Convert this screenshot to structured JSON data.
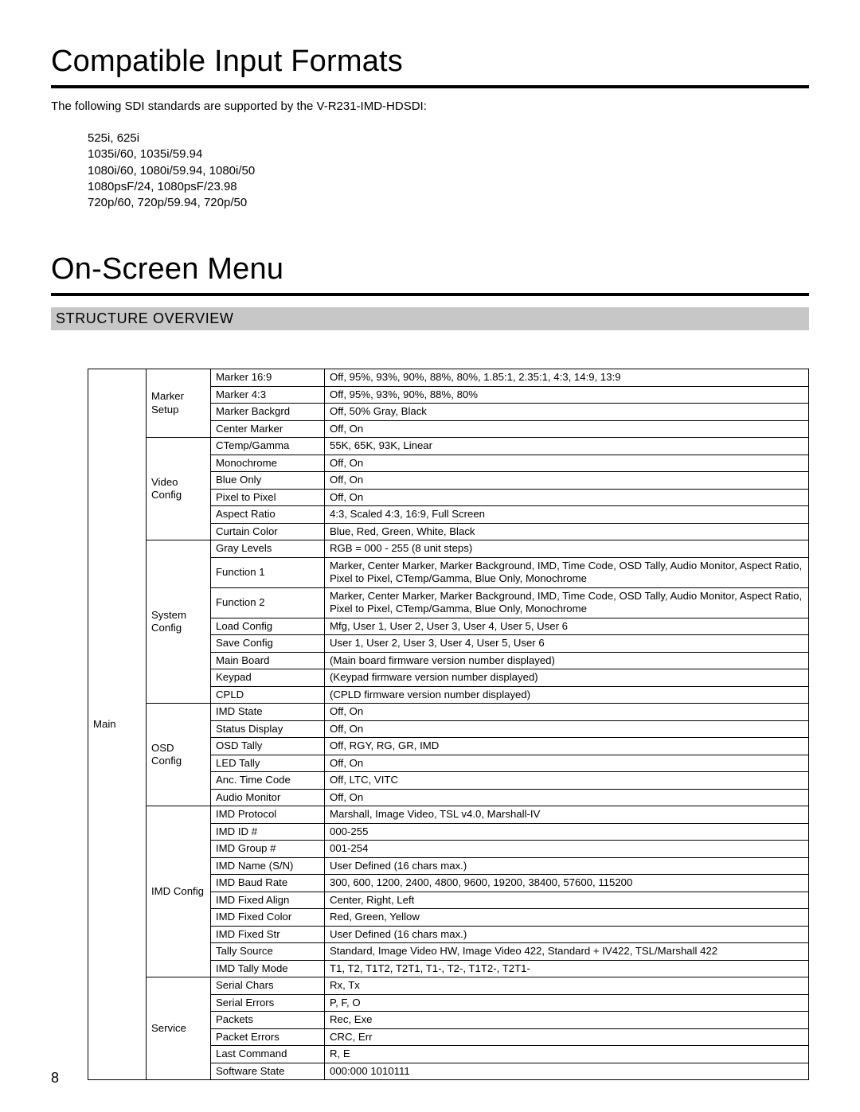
{
  "section1": {
    "title": "Compatible Input Formats",
    "intro": "The following SDI standards are supported by the V-R231-IMD-HDSDI:",
    "formats": [
      "525i, 625i",
      "1035i/60, 1035i/59.94",
      "1080i/60, 1080i/59.94, 1080i/50",
      "1080psF/24, 1080psF/23.98",
      "720p/60, 720p/59.94, 720p/50"
    ]
  },
  "section2": {
    "title": "On-Screen Menu",
    "subtitle": "STRUCTURE OVERVIEW"
  },
  "menu": {
    "root": "Main",
    "categories": [
      {
        "name": "Marker Setup",
        "rows": [
          {
            "p": "Marker 16:9",
            "v": "Off, 95%, 93%, 90%, 88%, 80%, 1.85:1, 2.35:1, 4:3, 14:9, 13:9"
          },
          {
            "p": "Marker 4:3",
            "v": "Off, 95%, 93%, 90%, 88%, 80%"
          },
          {
            "p": "Marker Backgrd",
            "v": "Off, 50% Gray, Black"
          },
          {
            "p": "Center Marker",
            "v": "Off, On"
          }
        ]
      },
      {
        "name": "Video Config",
        "rows": [
          {
            "p": "CTemp/Gamma",
            "v": "55K, 65K, 93K, Linear"
          },
          {
            "p": "Monochrome",
            "v": "Off, On"
          },
          {
            "p": "Blue Only",
            "v": "Off, On"
          },
          {
            "p": "Pixel to Pixel",
            "v": "Off, On"
          },
          {
            "p": "Aspect Ratio",
            "v": "4:3, Scaled 4:3, 16:9, Full Screen"
          },
          {
            "p": "Curtain Color",
            "v": "Blue, Red, Green, White, Black"
          }
        ]
      },
      {
        "name": "System Config",
        "rows": [
          {
            "p": "Gray Levels",
            "v": "RGB = 000 - 255 (8 unit steps)"
          },
          {
            "p": "Function 1",
            "v": "Marker, Center Marker, Marker Background, IMD, Time Code, OSD Tally, Audio Monitor, Aspect Ratio, Pixel to Pixel, CTemp/Gamma, Blue Only, Monochrome"
          },
          {
            "p": "Function 2",
            "v": "Marker, Center Marker, Marker Background, IMD, Time Code, OSD Tally, Audio Monitor, Aspect Ratio, Pixel to Pixel, CTemp/Gamma, Blue Only, Monochrome"
          },
          {
            "p": "Load Config",
            "v": "Mfg, User 1, User 2, User 3, User 4, User 5, User 6"
          },
          {
            "p": "Save Config",
            "v": "User 1, User 2, User 3, User 4, User 5, User 6"
          },
          {
            "p": "Main Board",
            "v": "(Main board firmware version number displayed)"
          },
          {
            "p": "Keypad",
            "v": "(Keypad firmware version number displayed)"
          },
          {
            "p": "CPLD",
            "v": "(CPLD firmware version number displayed)"
          }
        ]
      },
      {
        "name": "OSD Config",
        "rows": [
          {
            "p": "IMD State",
            "v": "Off, On"
          },
          {
            "p": "Status Display",
            "v": "Off, On"
          },
          {
            "p": "OSD Tally",
            "v": "Off, RGY, RG, GR, IMD"
          },
          {
            "p": "LED Tally",
            "v": "Off, On"
          },
          {
            "p": "Anc. Time Code",
            "v": "Off, LTC, VITC"
          },
          {
            "p": "Audio Monitor",
            "v": "Off, On"
          }
        ]
      },
      {
        "name": "IMD Config",
        "rows": [
          {
            "p": "IMD Protocol",
            "v": "Marshall, Image Video, TSL v4.0, Marshall-IV"
          },
          {
            "p": "IMD ID #",
            "v": "000-255"
          },
          {
            "p": "IMD Group #",
            "v": "001-254"
          },
          {
            "p": "IMD Name (S/N)",
            "v": "User Defined (16 chars max.)"
          },
          {
            "p": "IMD Baud Rate",
            "v": "300, 600, 1200, 2400, 4800, 9600, 19200, 38400, 57600, 115200"
          },
          {
            "p": "IMD Fixed Align",
            "v": "Center, Right, Left"
          },
          {
            "p": "IMD Fixed Color",
            "v": "Red, Green, Yellow"
          },
          {
            "p": "IMD Fixed Str",
            "v": "User Defined (16 chars max.)"
          },
          {
            "p": "Tally Source",
            "v": "Standard, Image Video HW, Image Video 422, Standard + IV422, TSL/Marshall 422"
          },
          {
            "p": "IMD Tally Mode",
            "v": "T1, T2, T1T2, T2T1, T1-, T2-, T1T2-, T2T1-"
          }
        ]
      },
      {
        "name": "Service",
        "rows": [
          {
            "p": "Serial Chars",
            "v": "Rx, Tx"
          },
          {
            "p": "Serial Errors",
            "v": "P, F, O"
          },
          {
            "p": "Packets",
            "v": "Rec, Exe"
          },
          {
            "p": "Packet Errors",
            "v": "CRC, Err"
          },
          {
            "p": "Last Command",
            "v": "R, E"
          },
          {
            "p": "Software State",
            "v": "000:000 1010111"
          }
        ]
      }
    ]
  },
  "pageNumber": "8"
}
